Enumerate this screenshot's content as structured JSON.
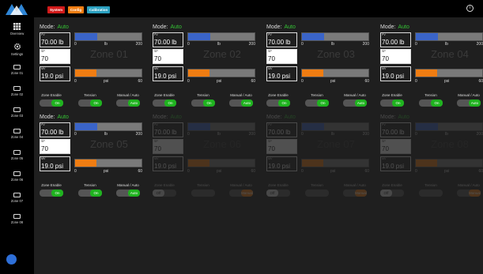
{
  "header": {
    "tabs": [
      {
        "label": "System",
        "color": "#d11a1a"
      },
      {
        "label": "Config",
        "color": "#f07d12"
      },
      {
        "label": "Calibration",
        "color": "#2a9fbf"
      }
    ],
    "info_icon": "info-icon"
  },
  "sidebar": {
    "items": [
      {
        "label": "Overview",
        "icon": "grid-icon"
      },
      {
        "label": "Settings",
        "icon": "gear-icon"
      },
      {
        "label": "Zone 01",
        "icon": "zone-icon"
      },
      {
        "label": "Zone 02",
        "icon": "zone-icon"
      },
      {
        "label": "Zone 03",
        "icon": "zone-icon"
      },
      {
        "label": "Zone 04",
        "icon": "zone-icon"
      },
      {
        "label": "Zone 05",
        "icon": "zone-icon"
      },
      {
        "label": "Zone 06",
        "icon": "zone-icon"
      },
      {
        "label": "Zone 07",
        "icon": "zone-icon"
      },
      {
        "label": "Zone 08",
        "icon": "zone-icon"
      }
    ]
  },
  "labels": {
    "mode": "Mode:",
    "pv": "PV",
    "sp": "SP",
    "mv": "MV",
    "zone_enable": "Zone Enable",
    "tension": "Tension",
    "manual_auto": "Manual / Auto"
  },
  "colors": {
    "pv_bar": "#3a64c8",
    "mv_bar": "#f07d12",
    "on": "#1fb31f",
    "mode_auto": "#35c435"
  },
  "zones": [
    {
      "name": "Zone 01",
      "mode": "Auto",
      "pv": "70.00 lb",
      "sp": "70",
      "mv": "19.0 psi",
      "pv_fraction": 0.33,
      "mv_fraction": 0.32,
      "pv_min": "0",
      "pv_unit": "lb",
      "pv_max": "200",
      "mv_min": "0",
      "mv_unit": "psi",
      "mv_max": "60",
      "zone_enable": "On",
      "tension": "On",
      "manual_auto": "Auto",
      "enabled": true
    },
    {
      "name": "Zone 02",
      "mode": "Auto",
      "pv": "70.00 lb",
      "sp": "70",
      "mv": "19.0 psi",
      "pv_fraction": 0.33,
      "mv_fraction": 0.32,
      "pv_min": "0",
      "pv_unit": "lb",
      "pv_max": "200",
      "mv_min": "0",
      "mv_unit": "psi",
      "mv_max": "60",
      "zone_enable": "On",
      "tension": "On",
      "manual_auto": "Auto",
      "enabled": true
    },
    {
      "name": "Zone 03",
      "mode": "Auto",
      "pv": "70.00 lb",
      "sp": "70",
      "mv": "19.0 psi",
      "pv_fraction": 0.33,
      "mv_fraction": 0.32,
      "pv_min": "0",
      "pv_unit": "lb",
      "pv_max": "200",
      "mv_min": "0",
      "mv_unit": "psi",
      "mv_max": "60",
      "zone_enable": "On",
      "tension": "On",
      "manual_auto": "Auto",
      "enabled": true
    },
    {
      "name": "Zone 04",
      "mode": "Auto",
      "pv": "70.00 lb",
      "sp": "70",
      "mv": "19.0 psi",
      "pv_fraction": 0.33,
      "mv_fraction": 0.32,
      "pv_min": "0",
      "pv_unit": "lb",
      "pv_max": "200",
      "mv_min": "0",
      "mv_unit": "psi",
      "mv_max": "60",
      "zone_enable": "On",
      "tension": "On",
      "manual_auto": "Auto",
      "enabled": true
    },
    {
      "name": "Zone 05",
      "mode": "Auto",
      "pv": "70.00 lb",
      "sp": "70",
      "mv": "19.0 psi",
      "pv_fraction": 0.33,
      "mv_fraction": 0.32,
      "pv_min": "0",
      "pv_unit": "lb",
      "pv_max": "200",
      "mv_min": "0",
      "mv_unit": "psi",
      "mv_max": "60",
      "zone_enable": "On",
      "tension": "On",
      "manual_auto": "Auto",
      "enabled": true
    },
    {
      "name": "Zone 06",
      "mode": "Auto",
      "pv": "70.00 lb",
      "sp": "70",
      "mv": "19.0 psi",
      "pv_fraction": 0.33,
      "mv_fraction": 0.32,
      "pv_min": "0",
      "pv_unit": "lb",
      "pv_max": "200",
      "mv_min": "0",
      "mv_unit": "psi",
      "mv_max": "60",
      "zone_enable": "Off",
      "tension": "",
      "manual_auto": "Manual",
      "enabled": false
    },
    {
      "name": "Zone 07",
      "mode": "Auto",
      "pv": "70.00 lb",
      "sp": "70",
      "mv": "19.0 psi",
      "pv_fraction": 0.33,
      "mv_fraction": 0.32,
      "pv_min": "0",
      "pv_unit": "lb",
      "pv_max": "200",
      "mv_min": "0",
      "mv_unit": "psi",
      "mv_max": "60",
      "zone_enable": "Off",
      "tension": "",
      "manual_auto": "Manual",
      "enabled": false
    },
    {
      "name": "Zone 08",
      "mode": "Auto",
      "pv": "70.00 lb",
      "sp": "70",
      "mv": "19.0 psi",
      "pv_fraction": 0.33,
      "mv_fraction": 0.32,
      "pv_min": "0",
      "pv_unit": "lb",
      "pv_max": "200",
      "mv_min": "0",
      "mv_unit": "psi",
      "mv_max": "60",
      "zone_enable": "Off",
      "tension": "",
      "manual_auto": "Manual",
      "enabled": false
    }
  ]
}
